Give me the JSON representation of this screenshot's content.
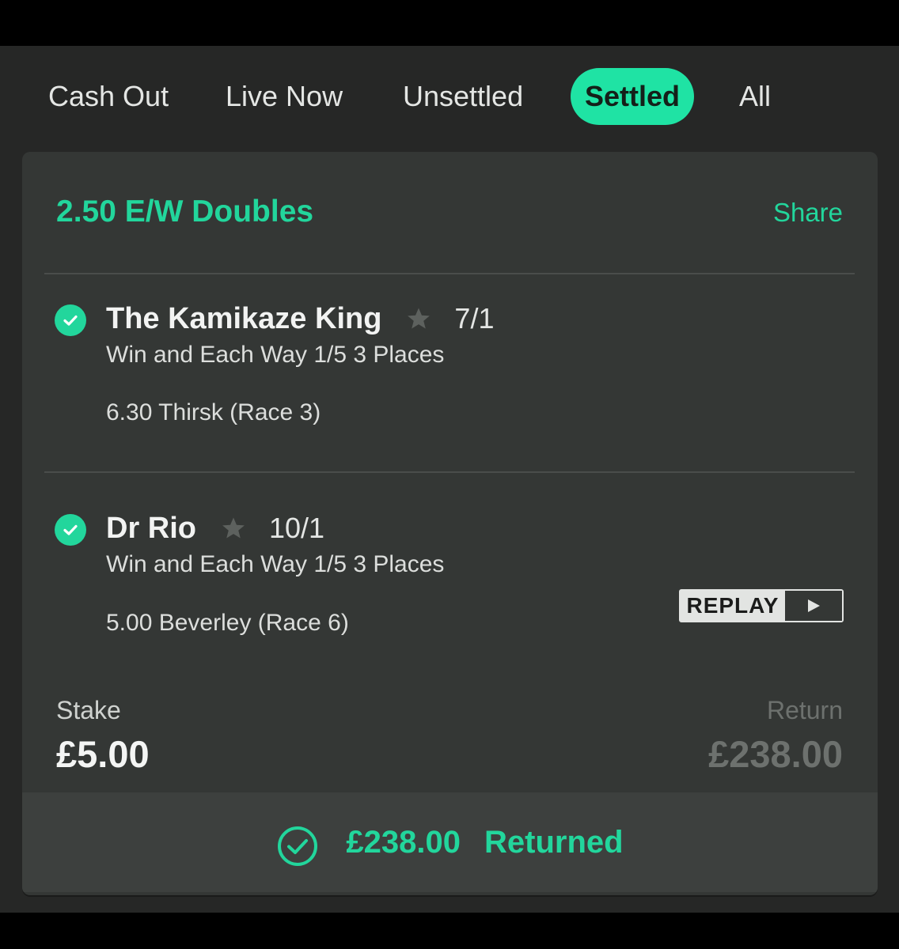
{
  "tabs": [
    {
      "label": "Cash Out",
      "active": false
    },
    {
      "label": "Live Now",
      "active": false
    },
    {
      "label": "Unsettled",
      "active": false
    },
    {
      "label": "Settled",
      "active": true
    },
    {
      "label": "All",
      "active": false
    }
  ],
  "bet": {
    "title": "2.50 E/W Doubles",
    "share_label": "Share",
    "selections": [
      {
        "horse": "The Kamikaze King",
        "odds": "7/1",
        "market": "Win and Each Way 1/5 3 Places",
        "race": "6.30 Thirsk (Race 3)",
        "status_icon": "check-circle-icon"
      },
      {
        "horse": "Dr Rio",
        "odds": "10/1",
        "market": "Win and Each Way 1/5 3 Places",
        "race": "5.00 Beverley (Race 6)",
        "status_icon": "check-circle-icon"
      }
    ],
    "replay_label": "REPLAY",
    "stake_label": "Stake",
    "stake_value": "£5.00",
    "return_label": "Return",
    "return_value": "£238.00",
    "footer": {
      "amount": "£238.00",
      "text": "Returned",
      "icon": "check-circle-outline-icon"
    }
  },
  "colors": {
    "accent": "#22d69c",
    "tab_active_bg": "#1fe3a4",
    "background": "#262726",
    "card": "#343735",
    "footer": "#3d403e",
    "muted": "#6d716e"
  }
}
